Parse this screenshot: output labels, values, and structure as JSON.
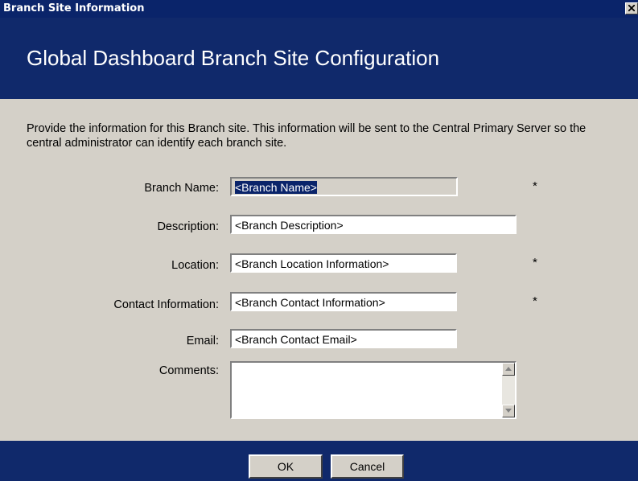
{
  "window": {
    "title": "Branch Site Information",
    "close_icon": "close-icon"
  },
  "header": {
    "heading": "Global Dashboard Branch Site Configuration",
    "background": "#10296b"
  },
  "intro": {
    "text": "Provide the information for this Branch site. This information will be sent to the Central Primary Server so the central administrator can identify each branch site."
  },
  "form": {
    "branch_name": {
      "label": "Branch Name:",
      "value": "<Branch Name>",
      "required": "*"
    },
    "description": {
      "label": "Description:",
      "value": "<Branch Description>"
    },
    "location": {
      "label": "Location:",
      "value": "<Branch Location Information>",
      "required": "*"
    },
    "contact": {
      "label": "Contact Information:",
      "value": "<Branch Contact Information>",
      "required": "*"
    },
    "email": {
      "label": "Email:",
      "value": "<Branch Contact Email>"
    },
    "comments": {
      "label": "Comments:",
      "value": ""
    }
  },
  "buttons": {
    "ok": "OK",
    "cancel": "Cancel"
  }
}
